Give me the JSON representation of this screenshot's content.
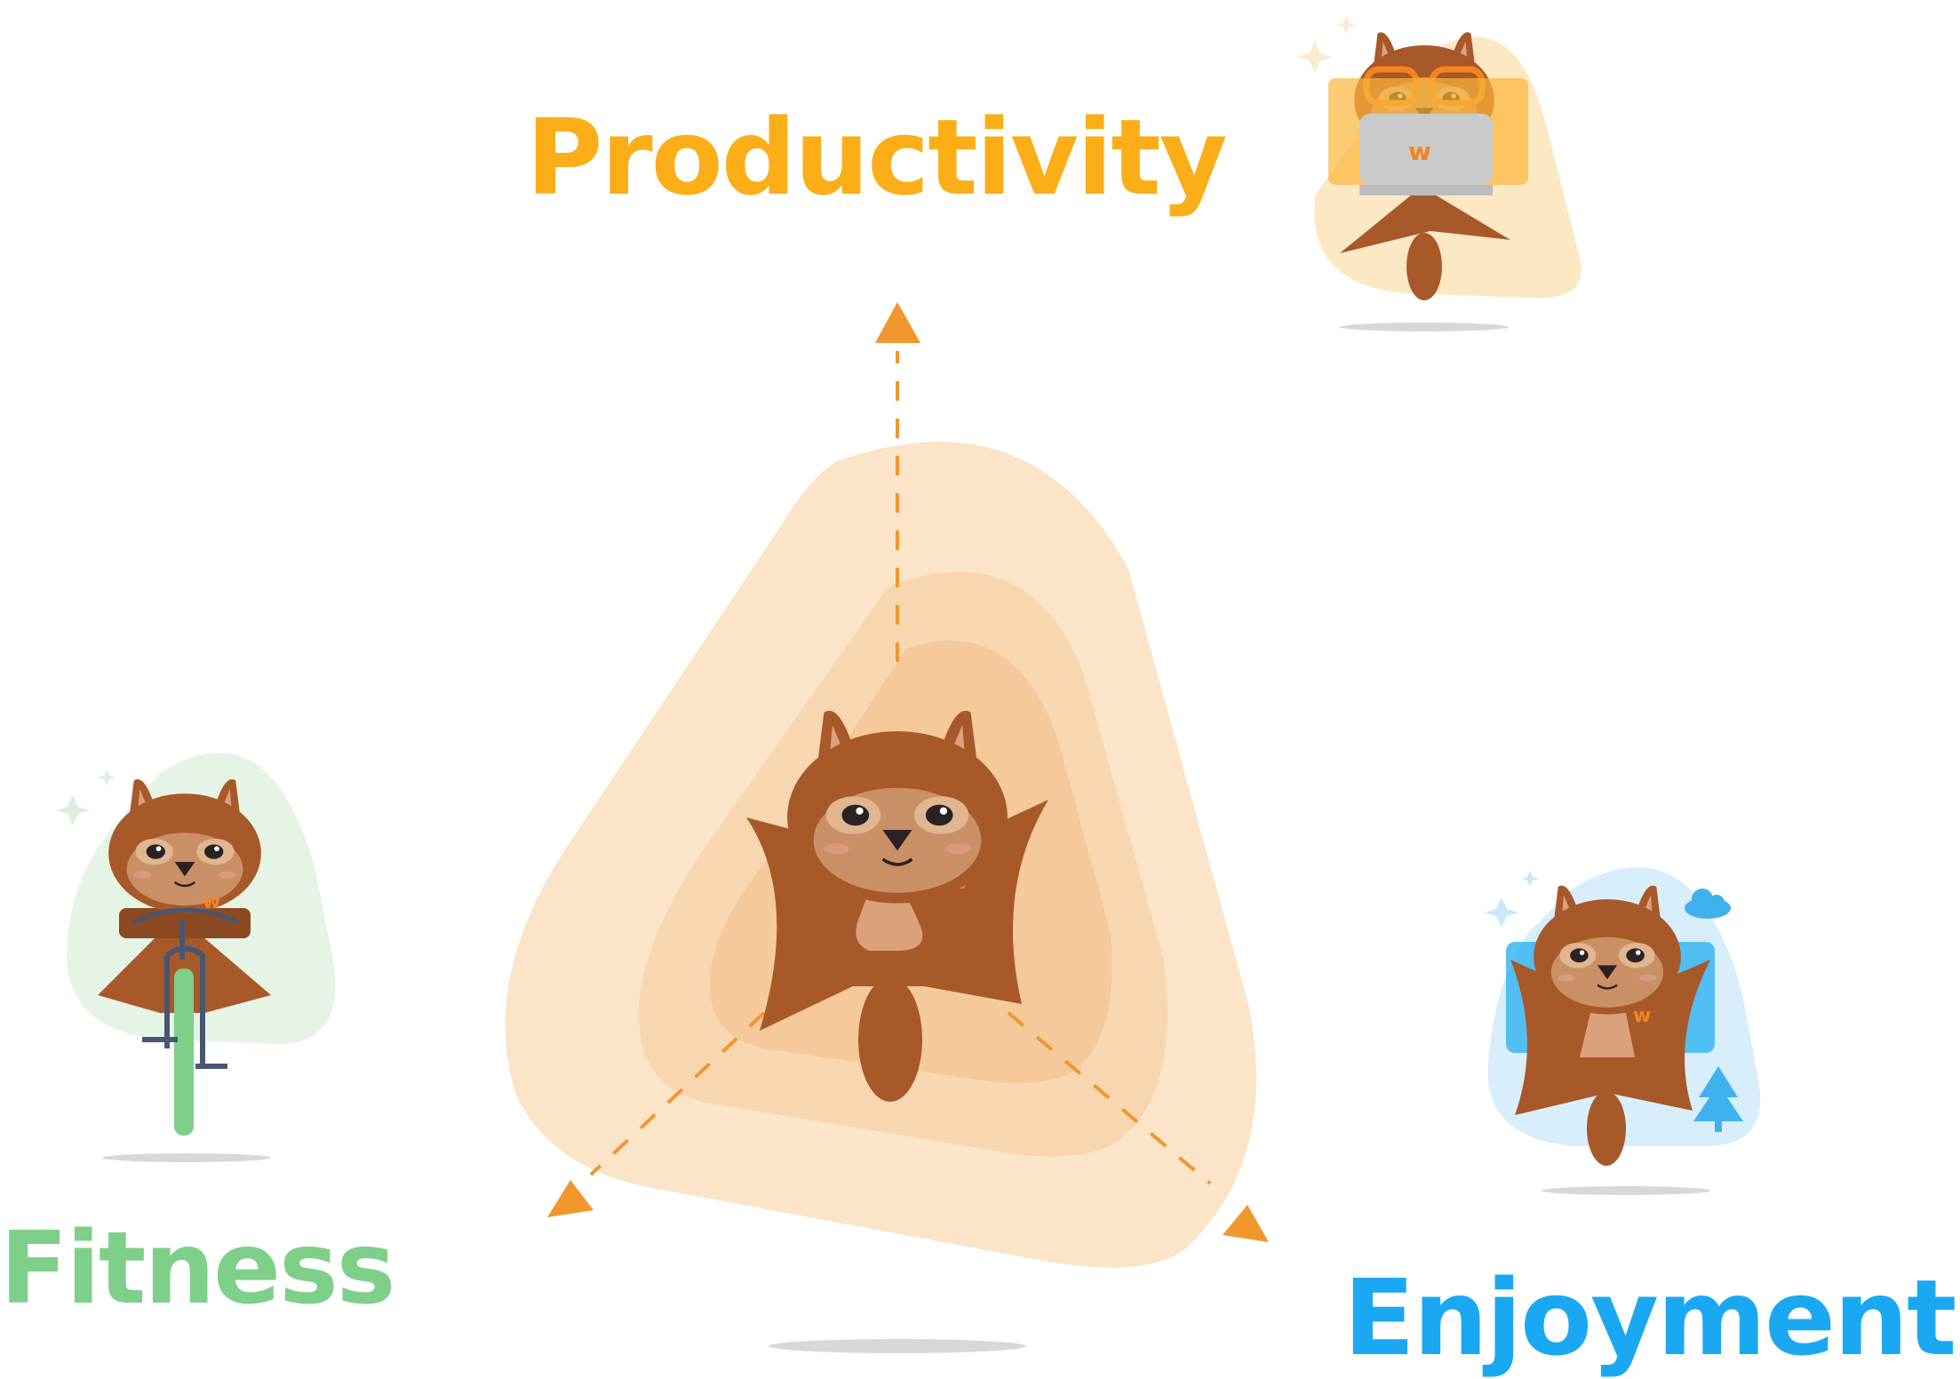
{
  "labels": {
    "productivity": "Productivity",
    "fitness": "Fitness",
    "enjoyment": "Enjoyment"
  },
  "badge_letter": "w",
  "colors": {
    "productivity": "#FBAE17",
    "fitness": "#7ECF8A",
    "enjoyment": "#1BA8F2",
    "arrow": "#F2962E",
    "fur_dark": "#A8592A",
    "fur_light": "#C99066",
    "blob_outer": "#FBE4C8",
    "blob_mid": "#F8D7B0",
    "blob_inner": "#F5C99A"
  },
  "icons": [
    "squirrel-icon",
    "laptop-icon",
    "glasses-icon",
    "bicycle-icon",
    "cloud-icon",
    "tree-icon",
    "sparkle-icon",
    "arrow-icon"
  ]
}
